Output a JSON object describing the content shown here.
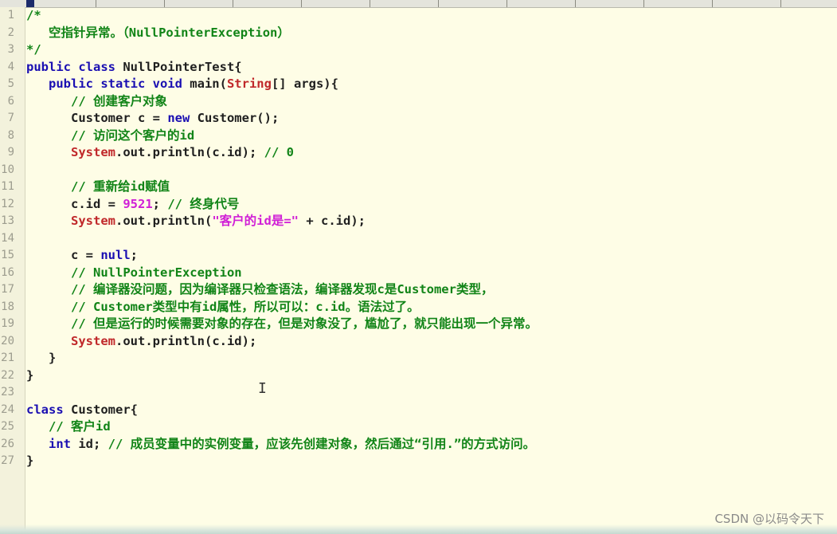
{
  "editor": {
    "lines": [
      {
        "num": "1",
        "tokens": [
          {
            "t": "/*",
            "c": "cmt"
          }
        ]
      },
      {
        "num": "2",
        "tokens": [
          {
            "t": "   空指针异常。（NullPointerException）",
            "c": "cmt"
          }
        ]
      },
      {
        "num": "3",
        "tokens": [
          {
            "t": "*/",
            "c": "cmt"
          }
        ]
      },
      {
        "num": "4",
        "tokens": [
          {
            "t": "public class",
            "c": "kw"
          },
          {
            "t": " NullPointerTest{",
            "c": "plain"
          }
        ]
      },
      {
        "num": "5",
        "tokens": [
          {
            "t": "   public static void",
            "c": "kw"
          },
          {
            "t": " main(",
            "c": "plain"
          },
          {
            "t": "String",
            "c": "cls"
          },
          {
            "t": "[] args){",
            "c": "plain"
          }
        ]
      },
      {
        "num": "6",
        "tokens": [
          {
            "t": "      // 创建客户对象",
            "c": "cmt"
          }
        ]
      },
      {
        "num": "7",
        "tokens": [
          {
            "t": "      Customer c = ",
            "c": "plain"
          },
          {
            "t": "new",
            "c": "kw"
          },
          {
            "t": " Customer();",
            "c": "plain"
          }
        ]
      },
      {
        "num": "8",
        "tokens": [
          {
            "t": "      // 访问这个客户的id",
            "c": "cmt"
          }
        ]
      },
      {
        "num": "9",
        "tokens": [
          {
            "t": "      ",
            "c": "plain"
          },
          {
            "t": "System",
            "c": "cls"
          },
          {
            "t": ".out.println(c.id); ",
            "c": "plain"
          },
          {
            "t": "// 0",
            "c": "cmt"
          }
        ]
      },
      {
        "num": "10",
        "tokens": []
      },
      {
        "num": "11",
        "tokens": [
          {
            "t": "      // 重新给id赋值",
            "c": "cmt"
          }
        ]
      },
      {
        "num": "12",
        "tokens": [
          {
            "t": "      c.id = ",
            "c": "plain"
          },
          {
            "t": "9521",
            "c": "num"
          },
          {
            "t": "; ",
            "c": "plain"
          },
          {
            "t": "// 终身代号",
            "c": "cmt"
          }
        ]
      },
      {
        "num": "13",
        "tokens": [
          {
            "t": "      ",
            "c": "plain"
          },
          {
            "t": "System",
            "c": "cls"
          },
          {
            "t": ".out.println(",
            "c": "plain"
          },
          {
            "t": "\"客户的id是=\"",
            "c": "str"
          },
          {
            "t": " + c.id);",
            "c": "plain"
          }
        ]
      },
      {
        "num": "14",
        "tokens": []
      },
      {
        "num": "15",
        "tokens": [
          {
            "t": "      c = ",
            "c": "plain"
          },
          {
            "t": "null",
            "c": "kw"
          },
          {
            "t": ";",
            "c": "plain"
          }
        ]
      },
      {
        "num": "16",
        "tokens": [
          {
            "t": "      // NullPointerException",
            "c": "cmt"
          }
        ]
      },
      {
        "num": "17",
        "tokens": [
          {
            "t": "      // 编译器没问题，因为编译器只检查语法，编译器发现c是Customer类型，",
            "c": "cmt"
          }
        ]
      },
      {
        "num": "18",
        "tokens": [
          {
            "t": "      // Customer类型中有id属性，所以可以：c.id。语法过了。",
            "c": "cmt"
          }
        ]
      },
      {
        "num": "19",
        "tokens": [
          {
            "t": "      // 但是运行的时候需要对象的存在，但是对象没了，尴尬了，就只能出现一个异常。",
            "c": "cmt"
          }
        ]
      },
      {
        "num": "20",
        "tokens": [
          {
            "t": "      ",
            "c": "plain"
          },
          {
            "t": "System",
            "c": "cls"
          },
          {
            "t": ".out.println(c.id);",
            "c": "plain"
          }
        ]
      },
      {
        "num": "21",
        "tokens": [
          {
            "t": "   }",
            "c": "plain"
          }
        ]
      },
      {
        "num": "22",
        "tokens": [
          {
            "t": "}",
            "c": "plain"
          }
        ]
      },
      {
        "num": "23",
        "tokens": []
      },
      {
        "num": "24",
        "tokens": [
          {
            "t": "class",
            "c": "kw"
          },
          {
            "t": " Customer{",
            "c": "plain"
          }
        ]
      },
      {
        "num": "25",
        "tokens": [
          {
            "t": "   // 客户id",
            "c": "cmt"
          }
        ]
      },
      {
        "num": "26",
        "tokens": [
          {
            "t": "   int",
            "c": "kw"
          },
          {
            "t": " id; ",
            "c": "plain"
          },
          {
            "t": "// 成员变量中的实例变量，应该先创建对象，然后通过“引用.”的方式访问。",
            "c": "cmt"
          }
        ]
      },
      {
        "num": "27",
        "tokens": [
          {
            "t": "}",
            "c": "plain"
          }
        ]
      }
    ]
  },
  "watermark": "CSDN @以码令天下",
  "colors": {
    "background": "#fefde6",
    "keyword": "#1a0fb2",
    "class_name": "#c0282a",
    "comment": "#118417",
    "string": "#d01fd6"
  }
}
